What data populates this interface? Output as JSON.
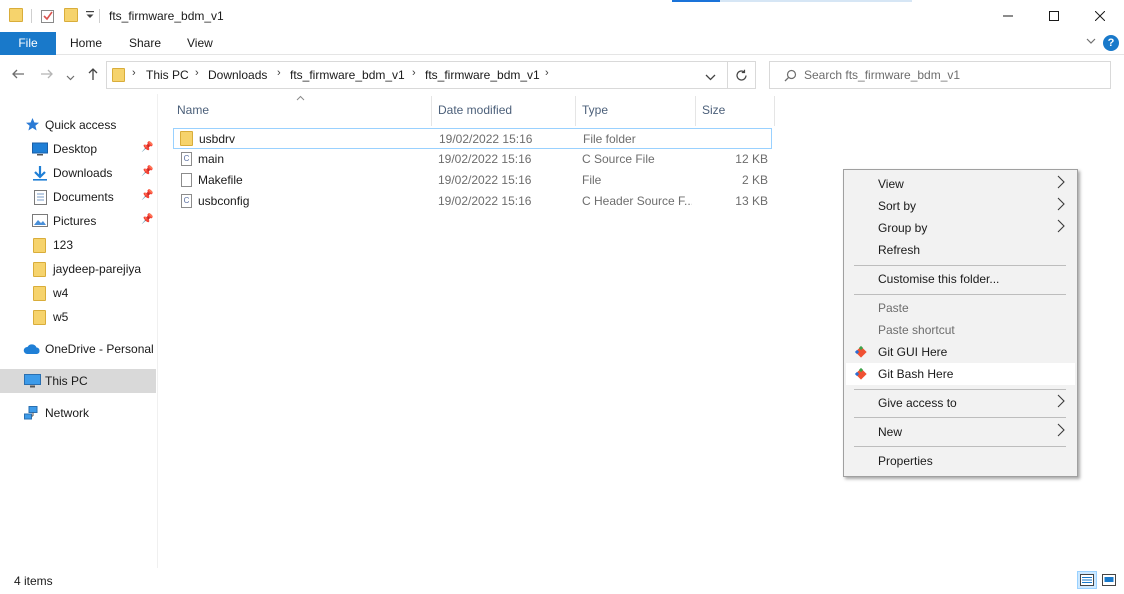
{
  "window": {
    "title": "fts_firmware_bdm_v1",
    "minimize_glyph": "—",
    "maximize_glyph": "☐",
    "close_glyph": "✕"
  },
  "ribbon": {
    "tabs": [
      "File",
      "Home",
      "Share",
      "View"
    ],
    "expand_glyph": "⌵",
    "help_glyph": "?"
  },
  "address": {
    "breadcrumbs": [
      "This PC",
      "Downloads",
      "fts_firmware_bdm_v1",
      "fts_firmware_bdm_v1"
    ],
    "search_placeholder": "Search fts_firmware_bdm_v1"
  },
  "nav_pane": {
    "items": [
      {
        "label": "Quick access",
        "icon": "star-icon"
      },
      {
        "label": "Desktop",
        "icon": "desktop-icon",
        "pinned": true
      },
      {
        "label": "Downloads",
        "icon": "download-arrow-icon",
        "pinned": true
      },
      {
        "label": "Documents",
        "icon": "documents-icon",
        "pinned": true
      },
      {
        "label": "Pictures",
        "icon": "pictures-icon",
        "pinned": true
      },
      {
        "label": "123",
        "icon": "folder-icon"
      },
      {
        "label": "jaydeep-parejiya",
        "icon": "folder-icon"
      },
      {
        "label": "w4",
        "icon": "folder-icon"
      },
      {
        "label": "w5",
        "icon": "folder-icon"
      },
      {
        "label": "OneDrive - Personal",
        "icon": "cloud-icon"
      },
      {
        "label": "This PC",
        "icon": "computer-icon",
        "selected": true
      },
      {
        "label": "Network",
        "icon": "network-icon"
      }
    ]
  },
  "file_list": {
    "columns": [
      "Name",
      "Date modified",
      "Type",
      "Size"
    ],
    "rows": [
      {
        "name": "usbdrv",
        "date": "19/02/2022 15:16",
        "type": "File folder",
        "size": "",
        "icon": "folder-icon"
      },
      {
        "name": "main",
        "date": "19/02/2022 15:16",
        "type": "C Source File",
        "size": "12 KB",
        "icon": "c-source-file-icon"
      },
      {
        "name": "Makefile",
        "date": "19/02/2022 15:16",
        "type": "File",
        "size": "2 KB",
        "icon": "file-icon"
      },
      {
        "name": "usbconfig",
        "date": "19/02/2022 15:16",
        "type": "C Header Source F...",
        "size": "13 KB",
        "icon": "c-header-file-icon"
      }
    ]
  },
  "status": {
    "item_count": "4 items"
  },
  "context_menu": {
    "view": "View",
    "sort_by": "Sort by",
    "group_by": "Group by",
    "refresh": "Refresh",
    "customise": "Customise this folder...",
    "paste": "Paste",
    "paste_shortcut": "Paste shortcut",
    "git_gui": "Git GUI Here",
    "git_bash": "Git Bash Here",
    "give_access": "Give access to",
    "new": "New",
    "properties": "Properties"
  },
  "colors": {
    "accent": "#1979ca",
    "folder": "#f6d36c",
    "selection": "#d9d9d9",
    "git_orange": "#f05133"
  }
}
